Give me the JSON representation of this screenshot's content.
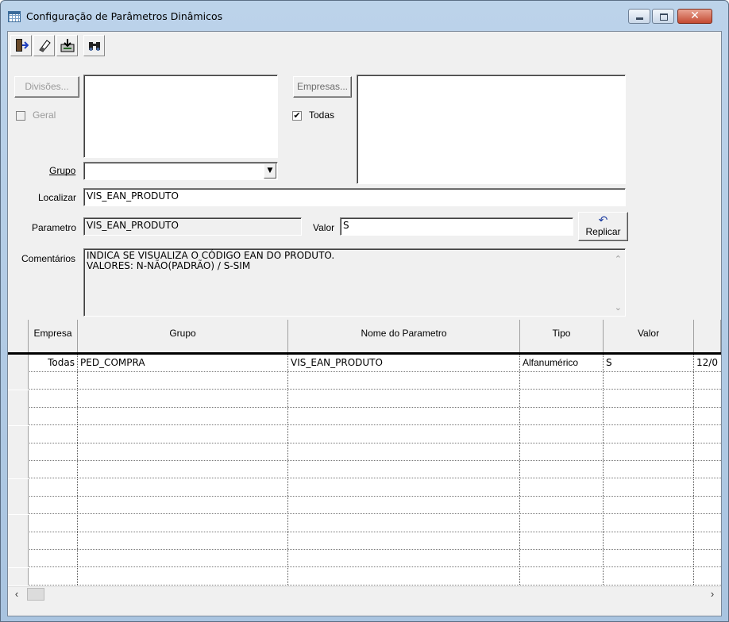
{
  "window": {
    "title": "Configuração de Parâmetros Dinâmicos",
    "close_glyph": "✕"
  },
  "toolbar": {
    "icons": [
      "exit-icon",
      "eraser-icon",
      "save-icon",
      "binoculars-icon"
    ]
  },
  "filters": {
    "divisoes_label": "Divisões...",
    "geral_label": "Geral",
    "empresas_label": "Empresas...",
    "todas_label": "Todas",
    "todas_checked": true,
    "grupo_label": "Grupo",
    "grupo_value": "",
    "localizar_label": "Localizar",
    "localizar_value": "VIS_EAN_PRODUTO"
  },
  "detail": {
    "parametro_label": "Parametro",
    "parametro_value": "VIS_EAN_PRODUTO",
    "valor_label": "Valor",
    "valor_value": "S",
    "replicar_label": "Replicar",
    "comentarios_label": "Comentários",
    "comentarios_line1": "INDICA SE VISUALIZA O CÓDIGO EAN DO PRODUTO.",
    "comentarios_line2": "VALORES: N-NÃO(PADRÃO) / S-SIM"
  },
  "grid": {
    "columns": [
      "Empresa",
      "Grupo",
      "Nome do Parametro",
      "Tipo",
      "Valor"
    ],
    "rows": [
      {
        "empresa": "Todas",
        "grupo": "PED_COMPRA",
        "nome": "VIS_EAN_PRODUTO",
        "tipo": "Alfanumérico",
        "valor": "S",
        "extra": "12/0"
      }
    ]
  }
}
